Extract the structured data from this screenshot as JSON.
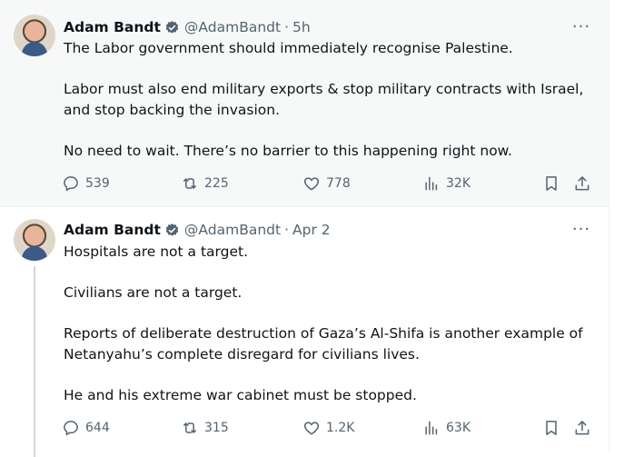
{
  "tweets": [
    {
      "author_name": "Adam Bandt",
      "handle": "@AdamBandt",
      "separator": "·",
      "time": "5h",
      "more": "···",
      "paragraphs": [
        "The Labor government should immediately recognise Palestine.",
        "Labor must also end military exports & stop military contracts with Israel, and stop backing the invasion.",
        "No need to wait. There’s no barrier to this happening right now."
      ],
      "replies": "539",
      "reposts": "225",
      "likes": "778",
      "views": "32K"
    },
    {
      "author_name": "Adam Bandt",
      "handle": "@AdamBandt",
      "separator": "·",
      "time": "Apr 2",
      "more": "···",
      "paragraphs": [
        "Hospitals are not a target.",
        "Civilians are not a target.",
        "Reports of deliberate destruction of Gaza’s Al-Shifa is another example of Netanyahu’s complete disregard for civilians lives.",
        "He and his extreme war cabinet must be stopped."
      ],
      "replies": "644",
      "reposts": "315",
      "likes": "1.2K",
      "views": "63K"
    }
  ],
  "colors": {
    "text": "#0f1419",
    "secondary": "#536471",
    "verified": "#1d9bf0",
    "hover_bg": "#f7f9f9"
  },
  "icons": [
    "verified-badge-icon",
    "more-icon",
    "reply-icon",
    "repost-icon",
    "like-icon",
    "views-icon",
    "bookmark-icon",
    "share-icon"
  ]
}
